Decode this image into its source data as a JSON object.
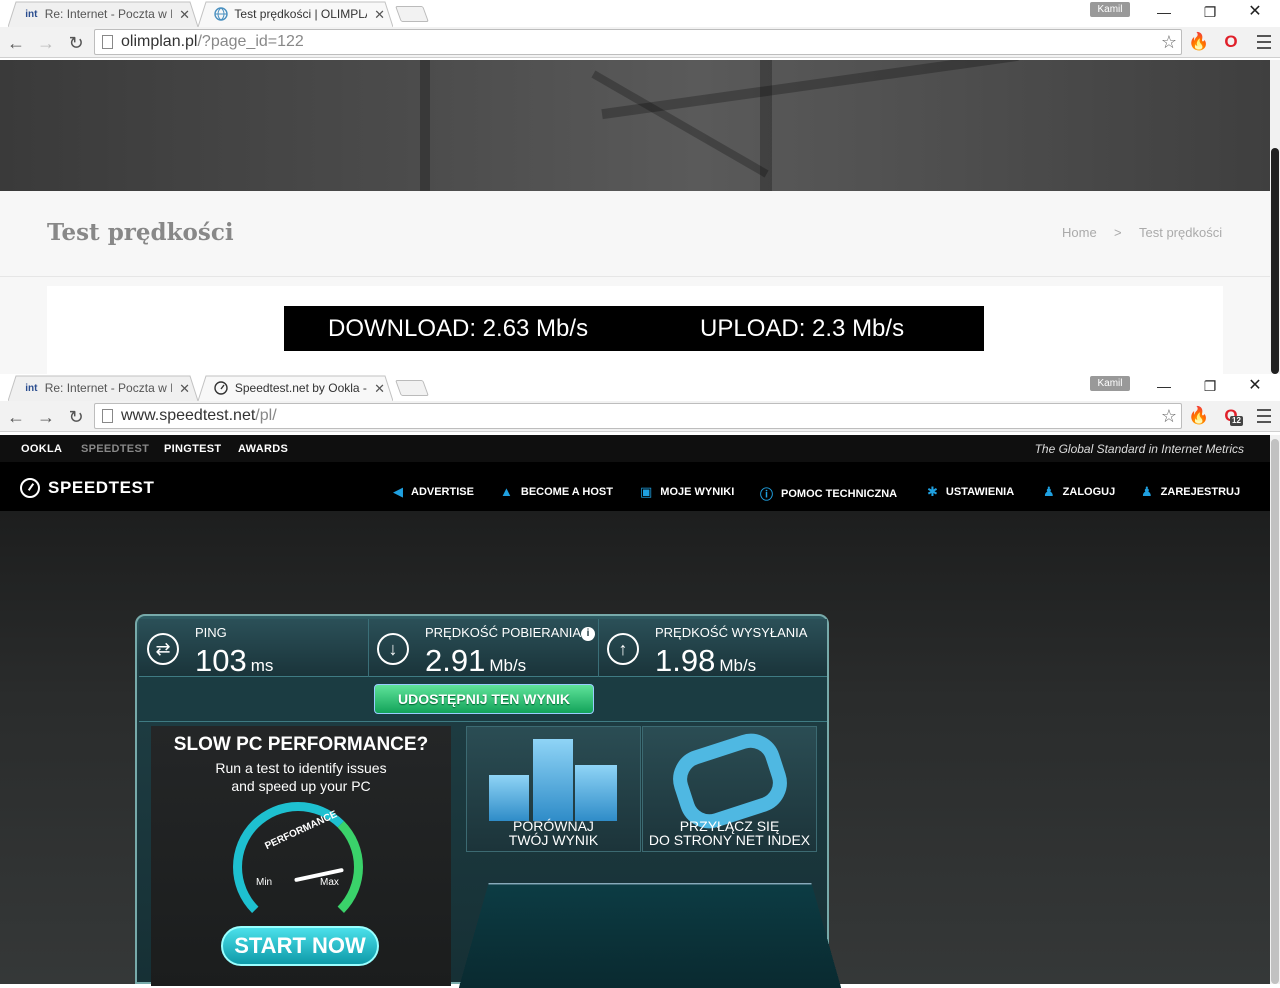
{
  "window_top": {
    "tabs": [
      {
        "favicon": "int",
        "label": "Re: Internet - Poczta w Int"
      },
      {
        "favicon": "globe-icon",
        "label": "Test prędkości | OLIMPLAN"
      }
    ],
    "profile": "Kamil",
    "url_host": "olimplan.pl",
    "url_path": "/?page_id=122",
    "page_title": "Test prędkości",
    "breadcrumb": {
      "home": "Home",
      "sep": ">",
      "current": "Test prędkości"
    },
    "result": {
      "download": "DOWNLOAD:  2.63 Mb/s",
      "upload": "UPLOAD:  2.3 Mb/s"
    }
  },
  "window_bottom": {
    "tabs": [
      {
        "favicon": "int",
        "label": "Re: Internet - Poczta w Int"
      },
      {
        "favicon": "gauge-icon",
        "label": "Speedtest.net by Ookla - T"
      }
    ],
    "profile": "Kamil",
    "url_host": "www.speedtest.net",
    "url_path": "/pl/",
    "ext_badge": "12",
    "ookla_nav": [
      "OOKLA",
      "SPEEDTEST",
      "PINGTEST",
      "AWARDS"
    ],
    "tagline": "The Global Standard in Internet Metrics",
    "logo": "SPEEDTEST",
    "links": [
      "ADVERTISE",
      "BECOME A HOST",
      "MOJE WYNIKI",
      "POMOC TECHNICZNA",
      "USTAWIENIA",
      "ZALOGUJ",
      "ZAREJESTRUJ"
    ],
    "stats": {
      "ping": {
        "label": "PING",
        "value": "103",
        "unit": "ms"
      },
      "download": {
        "label": "PRĘDKOŚĆ POBIERANIA",
        "value": "2.91",
        "unit": "Mb/s"
      },
      "upload": {
        "label": "PRĘDKOŚĆ WYSYŁANIA",
        "value": "1.98",
        "unit": "Mb/s"
      }
    },
    "share_button": "UDOSTĘPNIJ TEN WYNIK",
    "ad": {
      "headline": "SLOW PC PERFORMANCE?",
      "line1": "Run a test to identify issues",
      "line2": "and speed up your PC",
      "gauge_title": "PERFORMANCE",
      "gauge_min": "Min",
      "gauge_max": "Max",
      "button": "START NOW"
    },
    "tile_compare": {
      "line1": "PORÓWNAJ",
      "line2": "TWÓJ WYNIK"
    },
    "tile_netindex": {
      "line1": "PRZYŁĄCZ SIĘ",
      "line2": "DO STRONY NET INDEX"
    }
  }
}
